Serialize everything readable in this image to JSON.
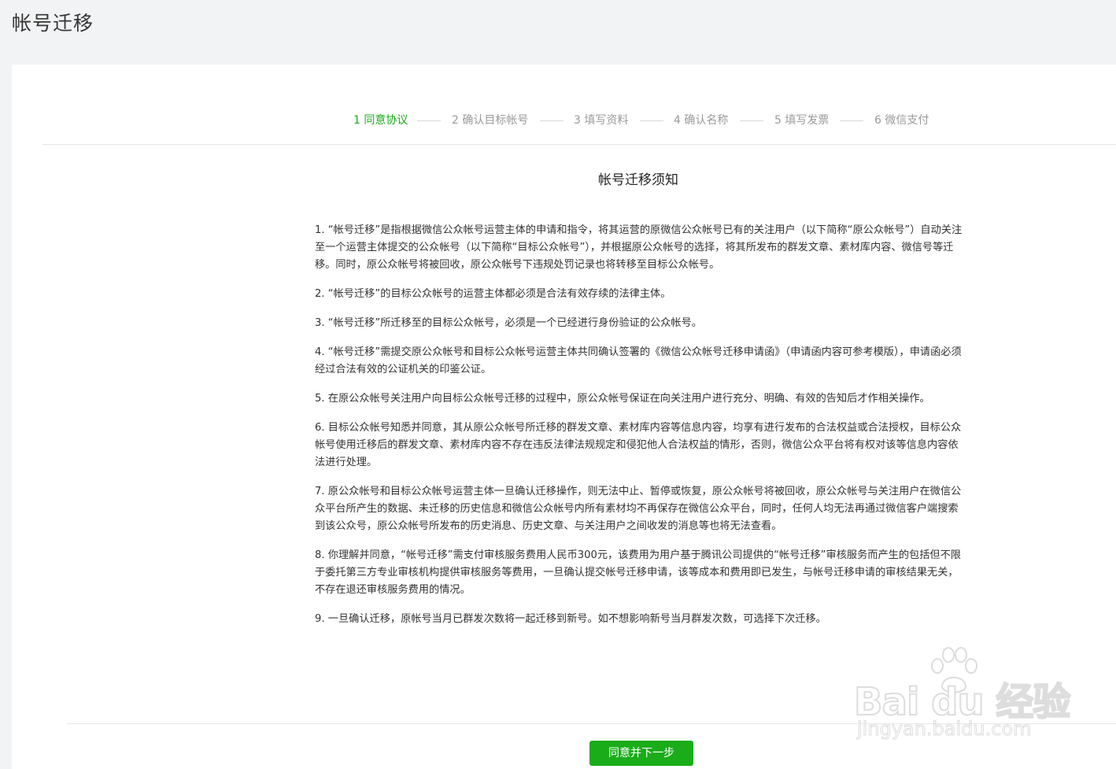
{
  "header": {
    "title": "帐号迁移"
  },
  "steps": [
    {
      "label": "1 同意协议",
      "active": true
    },
    {
      "label": "2 确认目标帐号",
      "active": false
    },
    {
      "label": "3 填写资料",
      "active": false
    },
    {
      "label": "4 确认名称",
      "active": false
    },
    {
      "label": "5 填写发票",
      "active": false
    },
    {
      "label": "6 微信支付",
      "active": false
    }
  ],
  "notice": {
    "title": "帐号迁移须知",
    "terms": [
      "1. “帐号迁移”是指根据微信公众帐号运营主体的申请和指令，将其运营的原微信公众帐号已有的关注用户（以下简称“原公众帐号”）自动关注至一个运营主体提交的公众帐号（以下简称“目标公众帐号”），并根据原公众帐号的选择，将其所发布的群发文章、素材库内容、微信号等迁移。同时，原公众帐号将被回收，原公众帐号下违规处罚记录也将转移至目标公众帐号。",
      "2. “帐号迁移”的目标公众帐号的运营主体都必须是合法有效存续的法律主体。",
      "3. “帐号迁移”所迁移至的目标公众帐号，必须是一个已经进行身份验证的公众帐号。",
      "4. “帐号迁移”需提交原公众帐号和目标公众帐号运营主体共同确认签署的《微信公众帐号迁移申请函》（申请函内容可参考模版），申请函必须经过合法有效的公证机关的印鉴公证。",
      "5. 在原公众帐号关注用户向目标公众帐号迁移的过程中，原公众帐号保证在向关注用户进行充分、明确、有效的告知后才作相关操作。",
      "6. 目标公众帐号知悉并同意，其从原公众帐号所迁移的群发文章、素材库内容等信息内容，均享有进行发布的合法权益或合法授权，目标公众帐号使用迁移后的群发文章、素材库内容不存在违反法律法规规定和侵犯他人合法权益的情形，否则，微信公众平台将有权对该等信息内容依法进行处理。",
      "7. 原公众帐号和目标公众帐号运营主体一旦确认迁移操作，则无法中止、暂停或恢复，原公众帐号将被回收，原公众帐号与关注用户在微信公众平台所产生的数据、未迁移的历史信息和微信公众帐号内所有素材均不再保存在微信公众平台，同时，任何人均无法再通过微信客户端搜索到该公众号，原公众帐号所发布的历史消息、历史文章、与关注用户之间收发的消息等也将无法查看。",
      "8. 你理解并同意，“帐号迁移”需支付审核服务费用人民币300元，该费用为用户基于腾讯公司提供的“帐号迁移”审核服务而产生的包括但不限于委托第三方专业审核机构提供审核服务等费用，一旦确认提交帐号迁移申请，该等成本和费用即已发生，与帐号迁移申请的审核结果无关，不存在退还审核服务费用的情况。",
      "9. 一旦确认迁移，原帐号当月已群发次数将一起迁移到新号。如不想影响新号当月群发次数，可选择下次迁移。"
    ]
  },
  "footer": {
    "agree_button": "同意并下一步"
  },
  "watermark": {
    "logo_text": "Bai  du 经验",
    "url_text": "jingyan.baidu.com"
  },
  "colors": {
    "accent": "#1aad19",
    "step_inactive": "#9a9a9a",
    "background": "#f2f3f5"
  }
}
